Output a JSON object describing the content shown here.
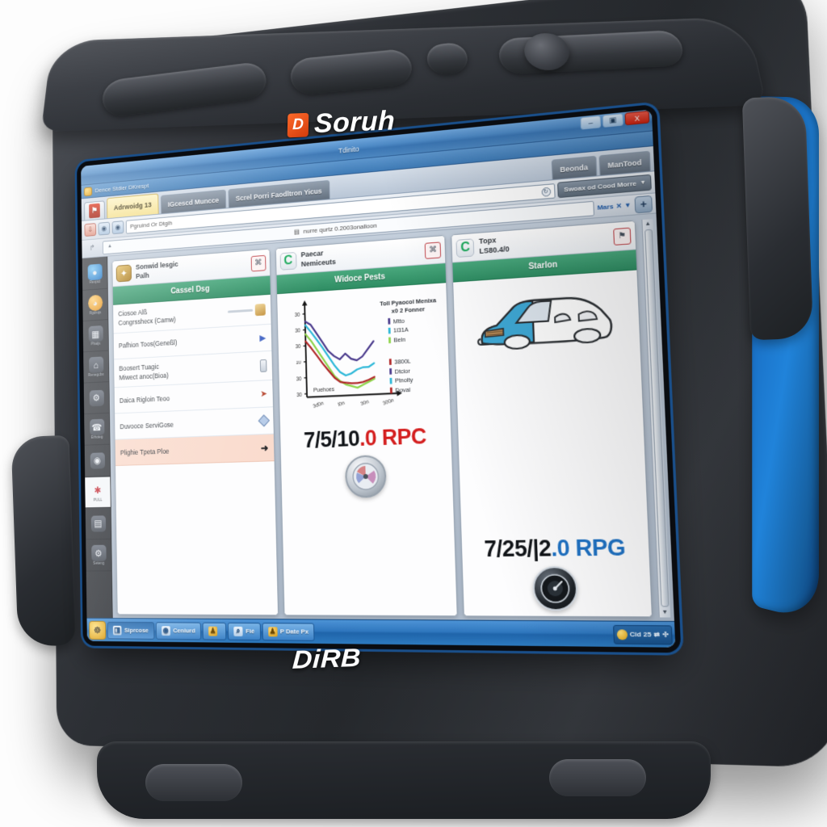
{
  "device": {
    "brand_top": "Soruh",
    "brand_mark": "D",
    "brand_bottom": "DiRB",
    "colors": {
      "body": "#2c2f34",
      "accent_blue": "#1a72c8",
      "bezel_blue": "#1a4f8a"
    }
  },
  "window": {
    "title": "Tdinito",
    "buttons": {
      "minimize": "–",
      "maximize": "▣",
      "close": "X"
    },
    "app_strip": "Dence Stdier DKrespt"
  },
  "tabs": {
    "flag_label": "⚑",
    "items": [
      {
        "label": "Adrwoidg 13",
        "active": true
      },
      {
        "label": "IGcescd Muncce",
        "active": false
      },
      {
        "label": "Screl Porri Faodltron Yicus",
        "active": false
      },
      {
        "label": "Beonda",
        "active": false
      },
      {
        "label": "ManTood",
        "active": false
      }
    ]
  },
  "toolbar": {
    "icons": [
      "arrow-icon",
      "disc-icon",
      "disc-icon"
    ],
    "field_value": "Pgruind Or Dtgih",
    "field_icon": "↻",
    "dropdown_label": "Swoax od Cood Morre",
    "dropdown_caret": "▼"
  },
  "addressbar": {
    "back_icon": "↱",
    "path": "nurre qurtz 0.2003onalloon",
    "path_icon": "▤",
    "right_label": "Mars",
    "right_close": "✕",
    "right_caret": "▼",
    "add_label": "+"
  },
  "rail": {
    "items": [
      {
        "icon_name": "globe-icon",
        "glyph": "●",
        "style": "g-blue",
        "label": "Rexpid",
        "selected": false
      },
      {
        "icon_name": "sun-icon",
        "glyph": "◕",
        "style": "g-orange",
        "label": "Rgdrojs",
        "selected": false
      },
      {
        "icon_name": "grid-icon",
        "glyph": "▦",
        "style": "g-grey",
        "label": "Phaijs",
        "selected": false
      },
      {
        "icon_name": "shield-icon",
        "glyph": "⌂",
        "style": "g-grey",
        "label": "Renegcbn",
        "selected": false
      },
      {
        "icon_name": "gear-icon",
        "glyph": "⚙",
        "style": "g-grey",
        "label": "",
        "selected": false
      },
      {
        "icon_name": "phone-icon",
        "glyph": "☎",
        "style": "g-grey",
        "label": "Erhoieg",
        "selected": false
      },
      {
        "icon_name": "eye-icon",
        "glyph": "◉",
        "style": "g-grey",
        "label": "",
        "selected": false
      },
      {
        "icon_name": "alert-icon",
        "glyph": "✱",
        "style": "g-grey",
        "label": "PULL",
        "selected": true
      },
      {
        "icon_name": "server-icon",
        "glyph": "▤",
        "style": "g-grey",
        "label": "",
        "selected": false
      },
      {
        "icon_name": "gear-icon",
        "glyph": "⚙",
        "style": "g-grey",
        "label": "Seteng",
        "selected": false
      }
    ]
  },
  "panels": [
    {
      "icon_name": "gold-book-icon",
      "icon_glyph": "✦",
      "icon_style": "gold",
      "title": "Sonwid lesgic\nPalh",
      "action_icon": "⌘",
      "band": "Cassel Dsg",
      "type": "menu",
      "rows": [
        {
          "text": "Ciosoe Alß\nCongrsshecк (Camw)",
          "accessory": "slider-figure",
          "highlight": false
        },
        {
          "text": "Pafhion Toos(Geneßl)",
          "accessory": "arrow-blue",
          "highlight": false
        },
        {
          "text": "Boosert Tuagic\nMiwect anoc(Bioa)",
          "accessory": "battery",
          "highlight": false
        },
        {
          "text": "Daica Rigloin Teoo",
          "accessory": "arrow-red",
          "highlight": false
        },
        {
          "text": "Duvooce ServiGose",
          "accessory": "diamond",
          "highlight": false
        },
        {
          "text": "Plighie Tpeta Ploe",
          "accessory": "arrow-dark",
          "highlight": true
        }
      ]
    },
    {
      "icon_name": "green-c-icon",
      "icon_glyph": "C",
      "icon_style": "c",
      "title": "Paecar\nNemiceuts",
      "action_icon": "⌘",
      "band": "Widoce Pests",
      "type": "chart",
      "readout": {
        "main": "7/5/10",
        "suffix": ".0 RPC",
        "accent": "red"
      },
      "gauge_icon": "gauge-light-icon",
      "gauge_glyph": "◔",
      "gauge_style": "light"
    },
    {
      "icon_name": "green-c-icon",
      "icon_glyph": "C",
      "icon_style": "c",
      "title": "Topx\nLS80.4/0",
      "action_icon": "⚑",
      "band": "Starlon",
      "type": "vehicle",
      "readout": {
        "main": "7/25/|2",
        "suffix": ".0 RPG",
        "accent": "blue"
      },
      "gauge_icon": "gauge-dark-icon",
      "gauge_glyph": "◔",
      "gauge_style": "dark"
    }
  ],
  "chart_data": {
    "type": "line",
    "title": "Toll Pyaocol Menixa\nx0 2 Fonner",
    "xlabel": "",
    "ylabel": "Puehoes",
    "x": [
      "3d0n",
      "l0n",
      "30n",
      "300n"
    ],
    "x_ticks": [
      "3d0n",
      "l0n",
      "30n",
      "300n"
    ],
    "y_ticks": [
      "30",
      "30",
      "30",
      "10",
      "30",
      "30"
    ],
    "ylim": [
      0,
      100
    ],
    "grid": false,
    "legend_position": "right",
    "legend_groups": [
      {
        "entries": [
          "Mtto",
          "1l31A",
          "Beln"
        ]
      },
      {
        "entries": [
          "3800L",
          "Dtcior",
          "Ptnolty",
          "Doval"
        ]
      }
    ],
    "series": [
      {
        "name": "Mtto",
        "color": "#4a3a8c",
        "values": [
          84,
          80,
          70,
          60,
          50,
          44,
          40,
          46,
          40,
          38,
          42,
          50,
          58
        ]
      },
      {
        "name": "1l31A",
        "color": "#2eb8d8",
        "values": [
          80,
          72,
          63,
          54,
          44,
          34,
          26,
          22,
          24,
          28,
          30,
          30,
          34
        ]
      },
      {
        "name": "Beln",
        "color": "#8ed44a",
        "values": [
          70,
          62,
          52,
          42,
          32,
          22,
          16,
          12,
          10,
          8,
          11,
          14,
          17
        ]
      },
      {
        "name": "Doval",
        "color": "#b02828",
        "values": [
          62,
          54,
          45,
          36,
          28,
          20,
          15,
          14,
          13,
          13,
          14,
          16,
          19
        ]
      }
    ]
  },
  "vehicle": {
    "art_name": "convertible-car-icon",
    "body_color": "#ffffff",
    "accent_color": "#35a8d8"
  },
  "taskbar": {
    "start_icon": "☸",
    "items": [
      {
        "label": "Siprcose",
        "icon": "◨",
        "pressed": true
      },
      {
        "label": "Ceniurd",
        "icon": "◉",
        "pressed": false
      },
      {
        "label": "",
        "icon": "♟",
        "pressed": false
      },
      {
        "label": "Fié",
        "icon": "⌕",
        "pressed": false
      },
      {
        "label": "P Date Px",
        "icon": "♟",
        "pressed": false
      }
    ],
    "tray": {
      "label": "Cid 25",
      "icons": [
        "⇄",
        "✣"
      ]
    }
  }
}
